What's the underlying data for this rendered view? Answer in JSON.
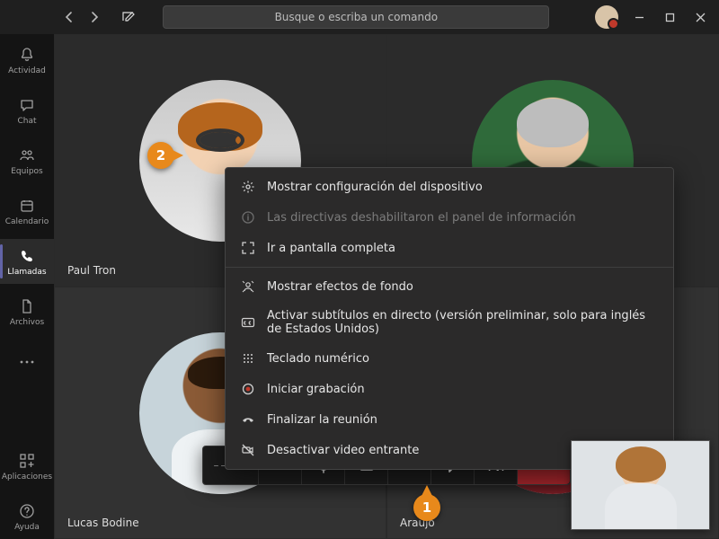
{
  "search": {
    "placeholder": "Busque o escriba un comando"
  },
  "rail": {
    "items": [
      {
        "label": "Actividad"
      },
      {
        "label": "Chat"
      },
      {
        "label": "Equipos"
      },
      {
        "label": "Calendario"
      },
      {
        "label": "Llamadas"
      },
      {
        "label": "Archivos"
      }
    ],
    "footer": [
      {
        "label": "Aplicaciones"
      },
      {
        "label": "Ayuda"
      }
    ]
  },
  "participants": [
    {
      "name": "Paul Tron"
    },
    {
      "name": ""
    },
    {
      "name": "Lucas Bodine"
    },
    {
      "name": "Araujo"
    }
  ],
  "callbar": {
    "timer": "––:––"
  },
  "menu": {
    "items": [
      {
        "label": "Mostrar configuración del dispositivo",
        "disabled": false
      },
      {
        "label": "Las directivas deshabilitaron el panel de información",
        "disabled": true
      },
      {
        "label": "Ir a pantalla completa",
        "disabled": false
      }
    ],
    "items2": [
      {
        "label": "Mostrar efectos de fondo"
      },
      {
        "label": "Activar subtítulos en directo (versión preliminar, solo para inglés de Estados Unidos)"
      },
      {
        "label": "Teclado numérico"
      },
      {
        "label": "Iniciar grabación"
      },
      {
        "label": "Finalizar la reunión"
      },
      {
        "label": "Desactivar video entrante"
      }
    ]
  },
  "annotations": {
    "one": "1",
    "two": "2"
  }
}
